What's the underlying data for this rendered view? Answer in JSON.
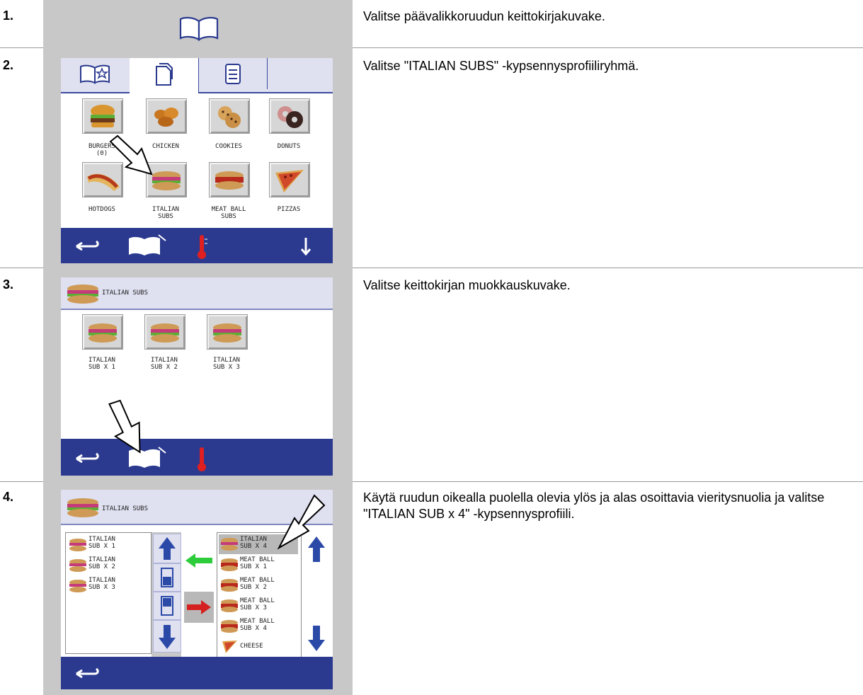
{
  "steps": [
    {
      "number": "1.",
      "text": "Valitse päävalikkoruudun keittokirjakuvake."
    },
    {
      "number": "2.",
      "text": "Valitse \"ITALIAN SUBS\" -kypsennysprofiiliryhmä."
    },
    {
      "number": "3.",
      "text": "Valitse keittokirjan muokkauskuvake."
    },
    {
      "number": "4.",
      "text": "Käytä ruudun oikealla puolella olevia ylös ja alas osoittavia vieritysnuolia ja valitse \"ITALIAN SUB x 4\" -kypsennysprofiili."
    }
  ],
  "screen2": {
    "tabs": [
      "cookbook-star-icon",
      "recipe-pages-icon",
      "document-icon"
    ],
    "tiles": [
      {
        "label": "BURGERS\n(0)"
      },
      {
        "label": "CHICKEN"
      },
      {
        "label": "COOKIES"
      },
      {
        "label": "DONUTS"
      },
      {
        "label": "HOTDOGS"
      },
      {
        "label": "ITALIAN\nSUBS"
      },
      {
        "label": "MEAT BALL\nSUBS"
      },
      {
        "label": "PIZZAS"
      }
    ]
  },
  "screen3": {
    "header": "ITALIAN SUBS",
    "items": [
      "ITALIAN\nSUB X 1",
      "ITALIAN\nSUB X 2",
      "ITALIAN\nSUB X 3"
    ]
  },
  "screen4": {
    "header": "ITALIAN SUBS",
    "left_list": [
      "ITALIAN\nSUB X 1",
      "ITALIAN\nSUB X 2",
      "ITALIAN\nSUB X 3"
    ],
    "right_list": [
      "ITALIAN\nSUB X 4",
      "MEAT BALL\nSUB X 1",
      "MEAT BALL\nSUB X 2",
      "MEAT BALL\nSUB X 3",
      "MEAT BALL\nSUB X 4",
      "CHEESE"
    ]
  },
  "colors": {
    "nav_blue": "#2b3a8f",
    "tab_lavender": "#dfe0f0",
    "panel_gray": "#c8c8c8",
    "green_arrow": "#2dcc3a",
    "red_arrow": "#d42020",
    "thermometer_red": "#e02020"
  }
}
